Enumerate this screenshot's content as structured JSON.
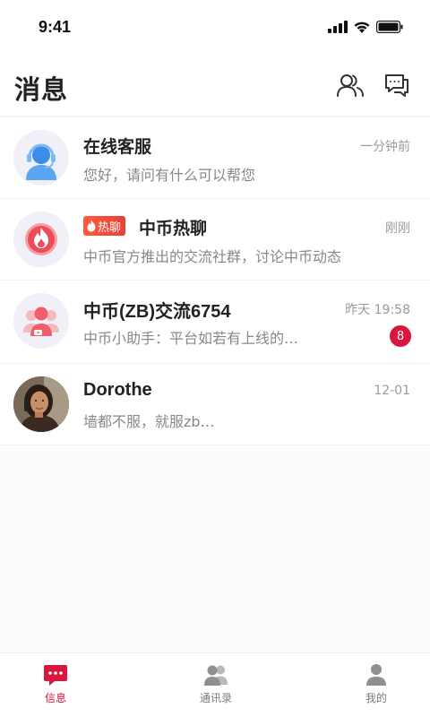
{
  "status_bar": {
    "time": "9:41"
  },
  "header": {
    "title": "消息",
    "contacts_icon": "contacts-icon",
    "chat_icon": "chat-bubbles-icon"
  },
  "conversations": [
    {
      "name": "在线客服",
      "preview": "您好，请问有什么可以帮您",
      "time": "一分钟前",
      "avatar_icon": "customer-service-icon"
    },
    {
      "tag": "热聊",
      "name": "中币热聊",
      "preview": "中币官方推出的交流社群，讨论中币动态",
      "time": "刚刚",
      "avatar_icon": "flame-icon"
    },
    {
      "name": "中币(ZB)交流6754",
      "preview": "中币小助手：平台如若有上线的…",
      "time": "昨天 19:58",
      "unread": "8",
      "avatar_icon": "group-icon"
    },
    {
      "name": "Dorothe",
      "preview": "墙都不服，就服zb…",
      "time": "12-01",
      "avatar_icon": "user-photo-avatar"
    }
  ],
  "tabbar": {
    "messages": "信息",
    "contacts": "通讯录",
    "mine": "我的"
  },
  "colors": {
    "accent": "#d8163e",
    "hot_tag": "#ee4a3a"
  }
}
